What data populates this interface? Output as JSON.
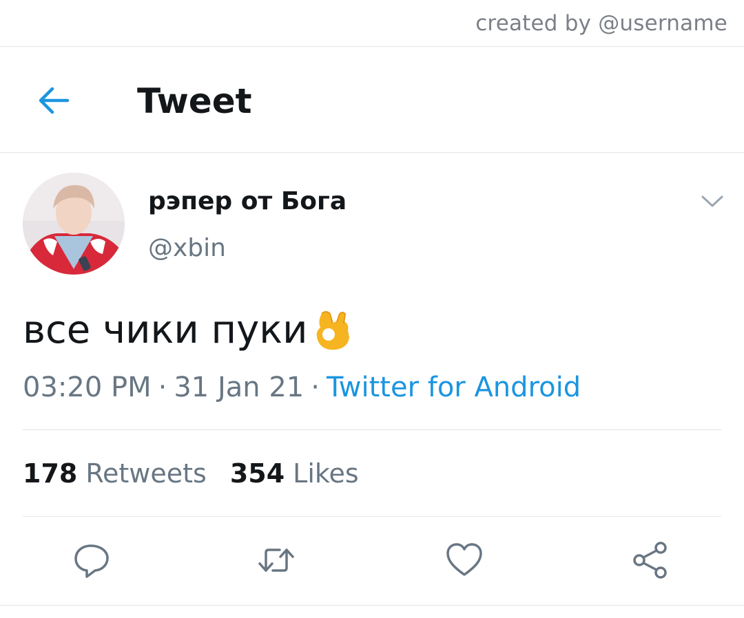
{
  "credit": "created by @username",
  "header": {
    "title": "Tweet",
    "back_icon": "arrow-left-icon"
  },
  "tweet": {
    "display_name": "рэпер от Бога",
    "handle": "@xbin",
    "text": "все чики пуки",
    "emoji_icon": "ok-hand-icon",
    "time": "03:20 PM",
    "date": "31 Jan 21",
    "separator": "·",
    "source": "Twitter for Android"
  },
  "stats": {
    "retweets_count": "178",
    "retweets_label": "Retweets",
    "likes_count": "354",
    "likes_label": "Likes"
  },
  "actions": [
    "reply-icon",
    "retweet-icon",
    "like-icon",
    "share-icon"
  ],
  "colors": {
    "accent": "#1b95e0",
    "text_primary": "#14171a",
    "text_secondary": "#687683",
    "icon": "#687683",
    "divider": "#e1e4e7"
  }
}
